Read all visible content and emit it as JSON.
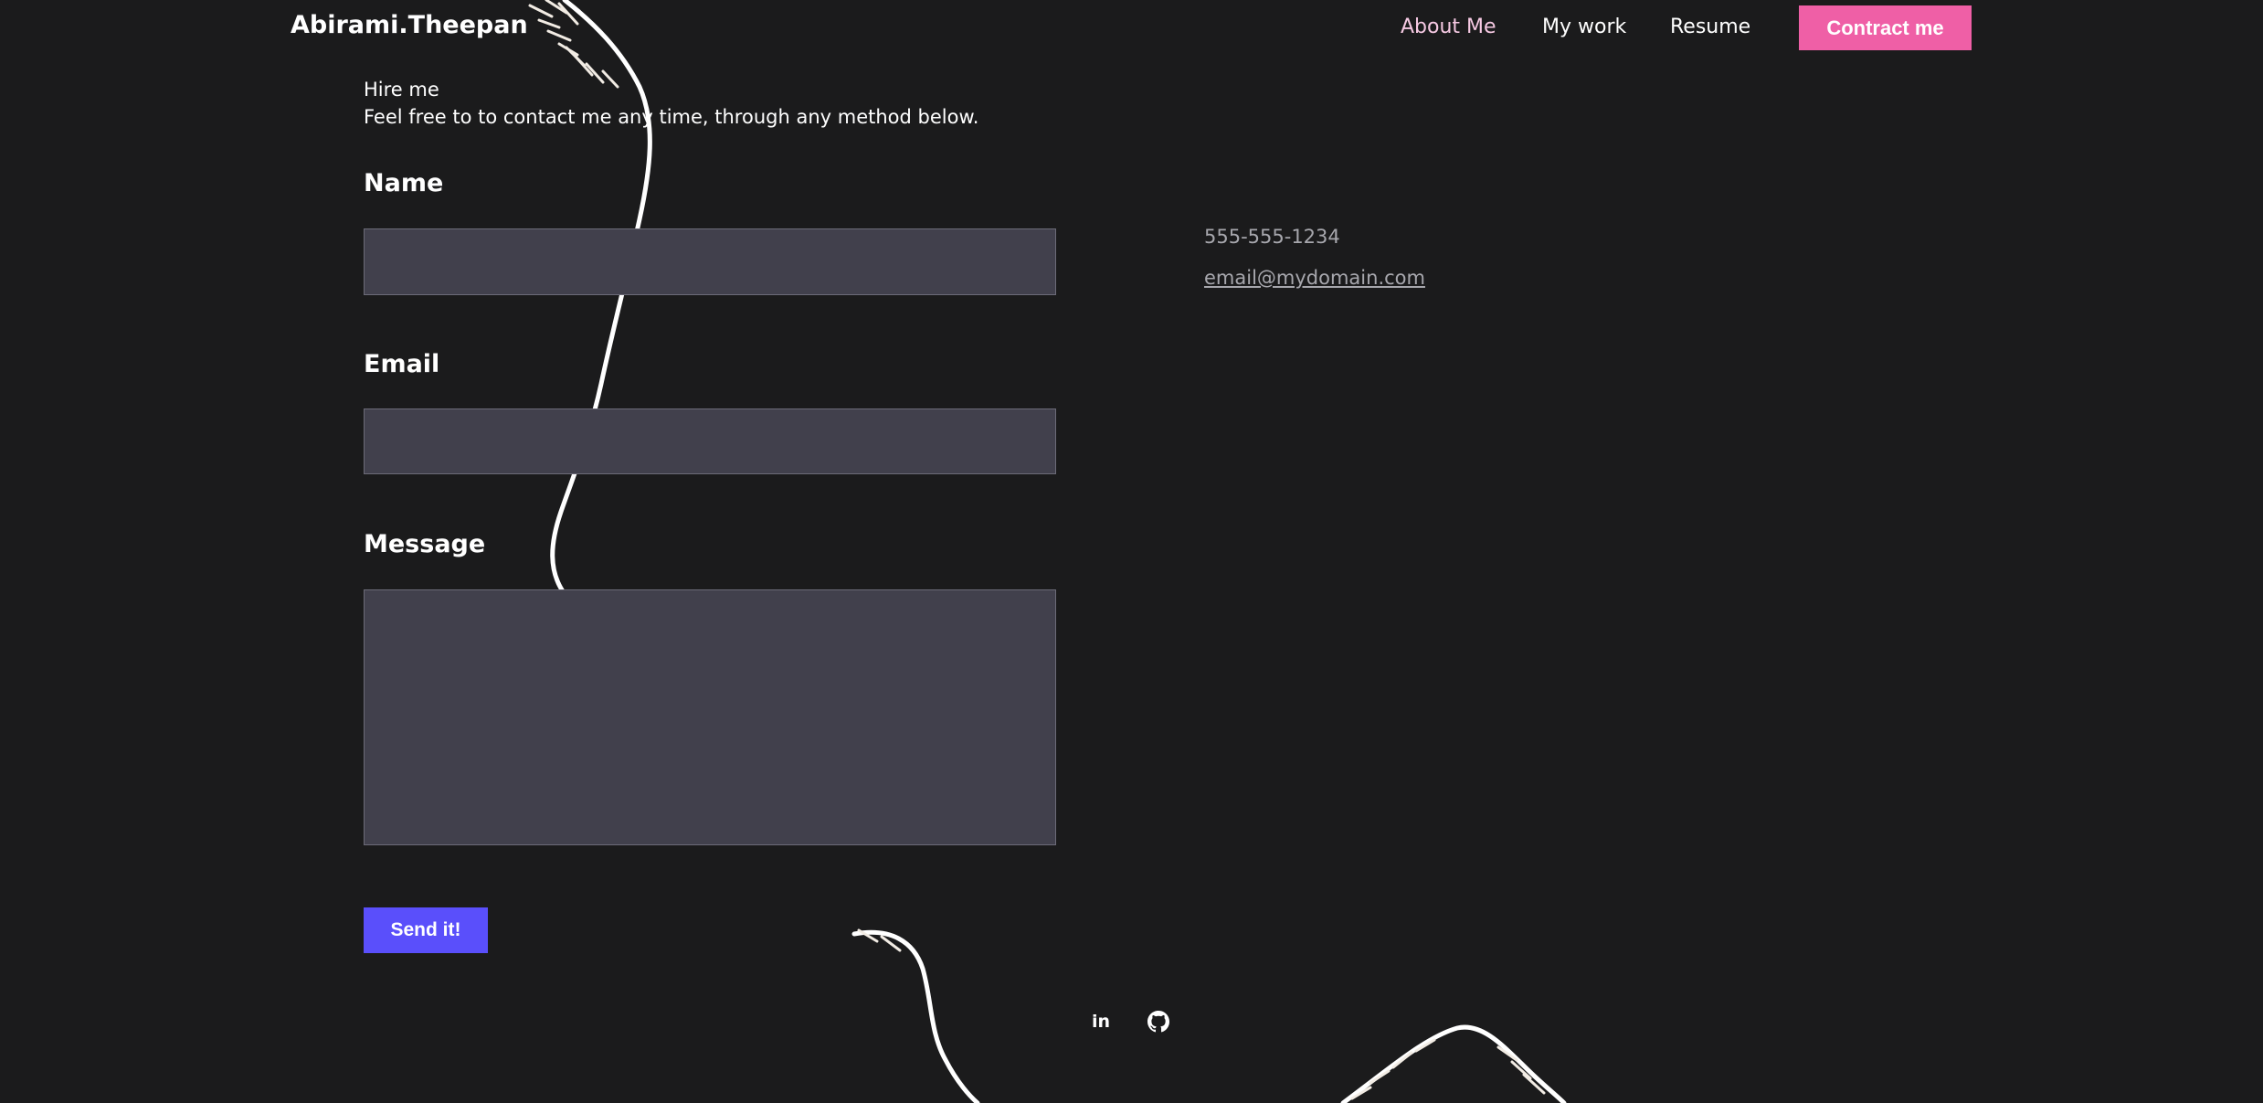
{
  "header": {
    "brand": "Abirami.Theepan",
    "nav": {
      "about": "About Me",
      "work": "My work",
      "resume": "Resume"
    },
    "cta_label": "Contract me"
  },
  "intro": {
    "title": "Hire me",
    "text": "Feel free to to contact me any time, through any method below."
  },
  "form": {
    "name_label": "Name",
    "email_label": "Email",
    "message_label": "Message",
    "name_value": "",
    "email_value": "",
    "message_value": "",
    "submit_label": "Send it!"
  },
  "contact": {
    "phone": "555-555-1234",
    "email": "email@mydomain.com"
  },
  "social": {
    "icons": [
      "linkedin-icon",
      "github-icon"
    ],
    "linkedin_glyph": "in"
  },
  "colors": {
    "background": "#1b1b1c",
    "cta": "#ef5fa6",
    "submit": "#5a4ffb",
    "field": "#41404c",
    "active_nav": "#f6c9e3",
    "muted_text": "#a7a7ad"
  }
}
